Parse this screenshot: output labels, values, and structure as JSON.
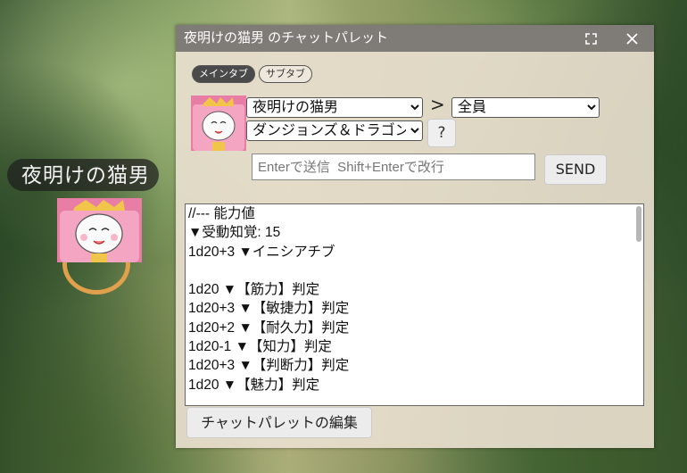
{
  "token": {
    "name": "夜明けの猫男"
  },
  "window": {
    "title": "夜明けの猫男 のチャットパレット",
    "tabs": [
      {
        "label": "メインタブ",
        "active": true
      },
      {
        "label": "サブタブ",
        "active": false
      }
    ],
    "character_select": "夜明けの猫男",
    "arrow": ">",
    "target_select": "全員",
    "system_select": "ダンジョンズ＆ドラゴンズ",
    "help_label": "?",
    "message_placeholder": "Enterで送信  Shift+Enterで改行",
    "send_label": "SEND",
    "palette_lines": [
      "//--- 能力値",
      "▼受動知覚: 15",
      "1d20+3 ▼イニシアチブ",
      "",
      "1d20 ▼【筋力】判定",
      "1d20+3 ▼【敏捷力】判定",
      "1d20+2 ▼【耐久力】判定",
      "1d20-1 ▼【知力】判定",
      "1d20+3 ▼【判断力】判定",
      "1d20 ▼【魅力】判定"
    ],
    "edit_label": "チャットパレットの編集"
  },
  "colors": {
    "titlebar": "#7f7b76",
    "window_bg": "#e8dece",
    "ring": "#e0a04c"
  }
}
